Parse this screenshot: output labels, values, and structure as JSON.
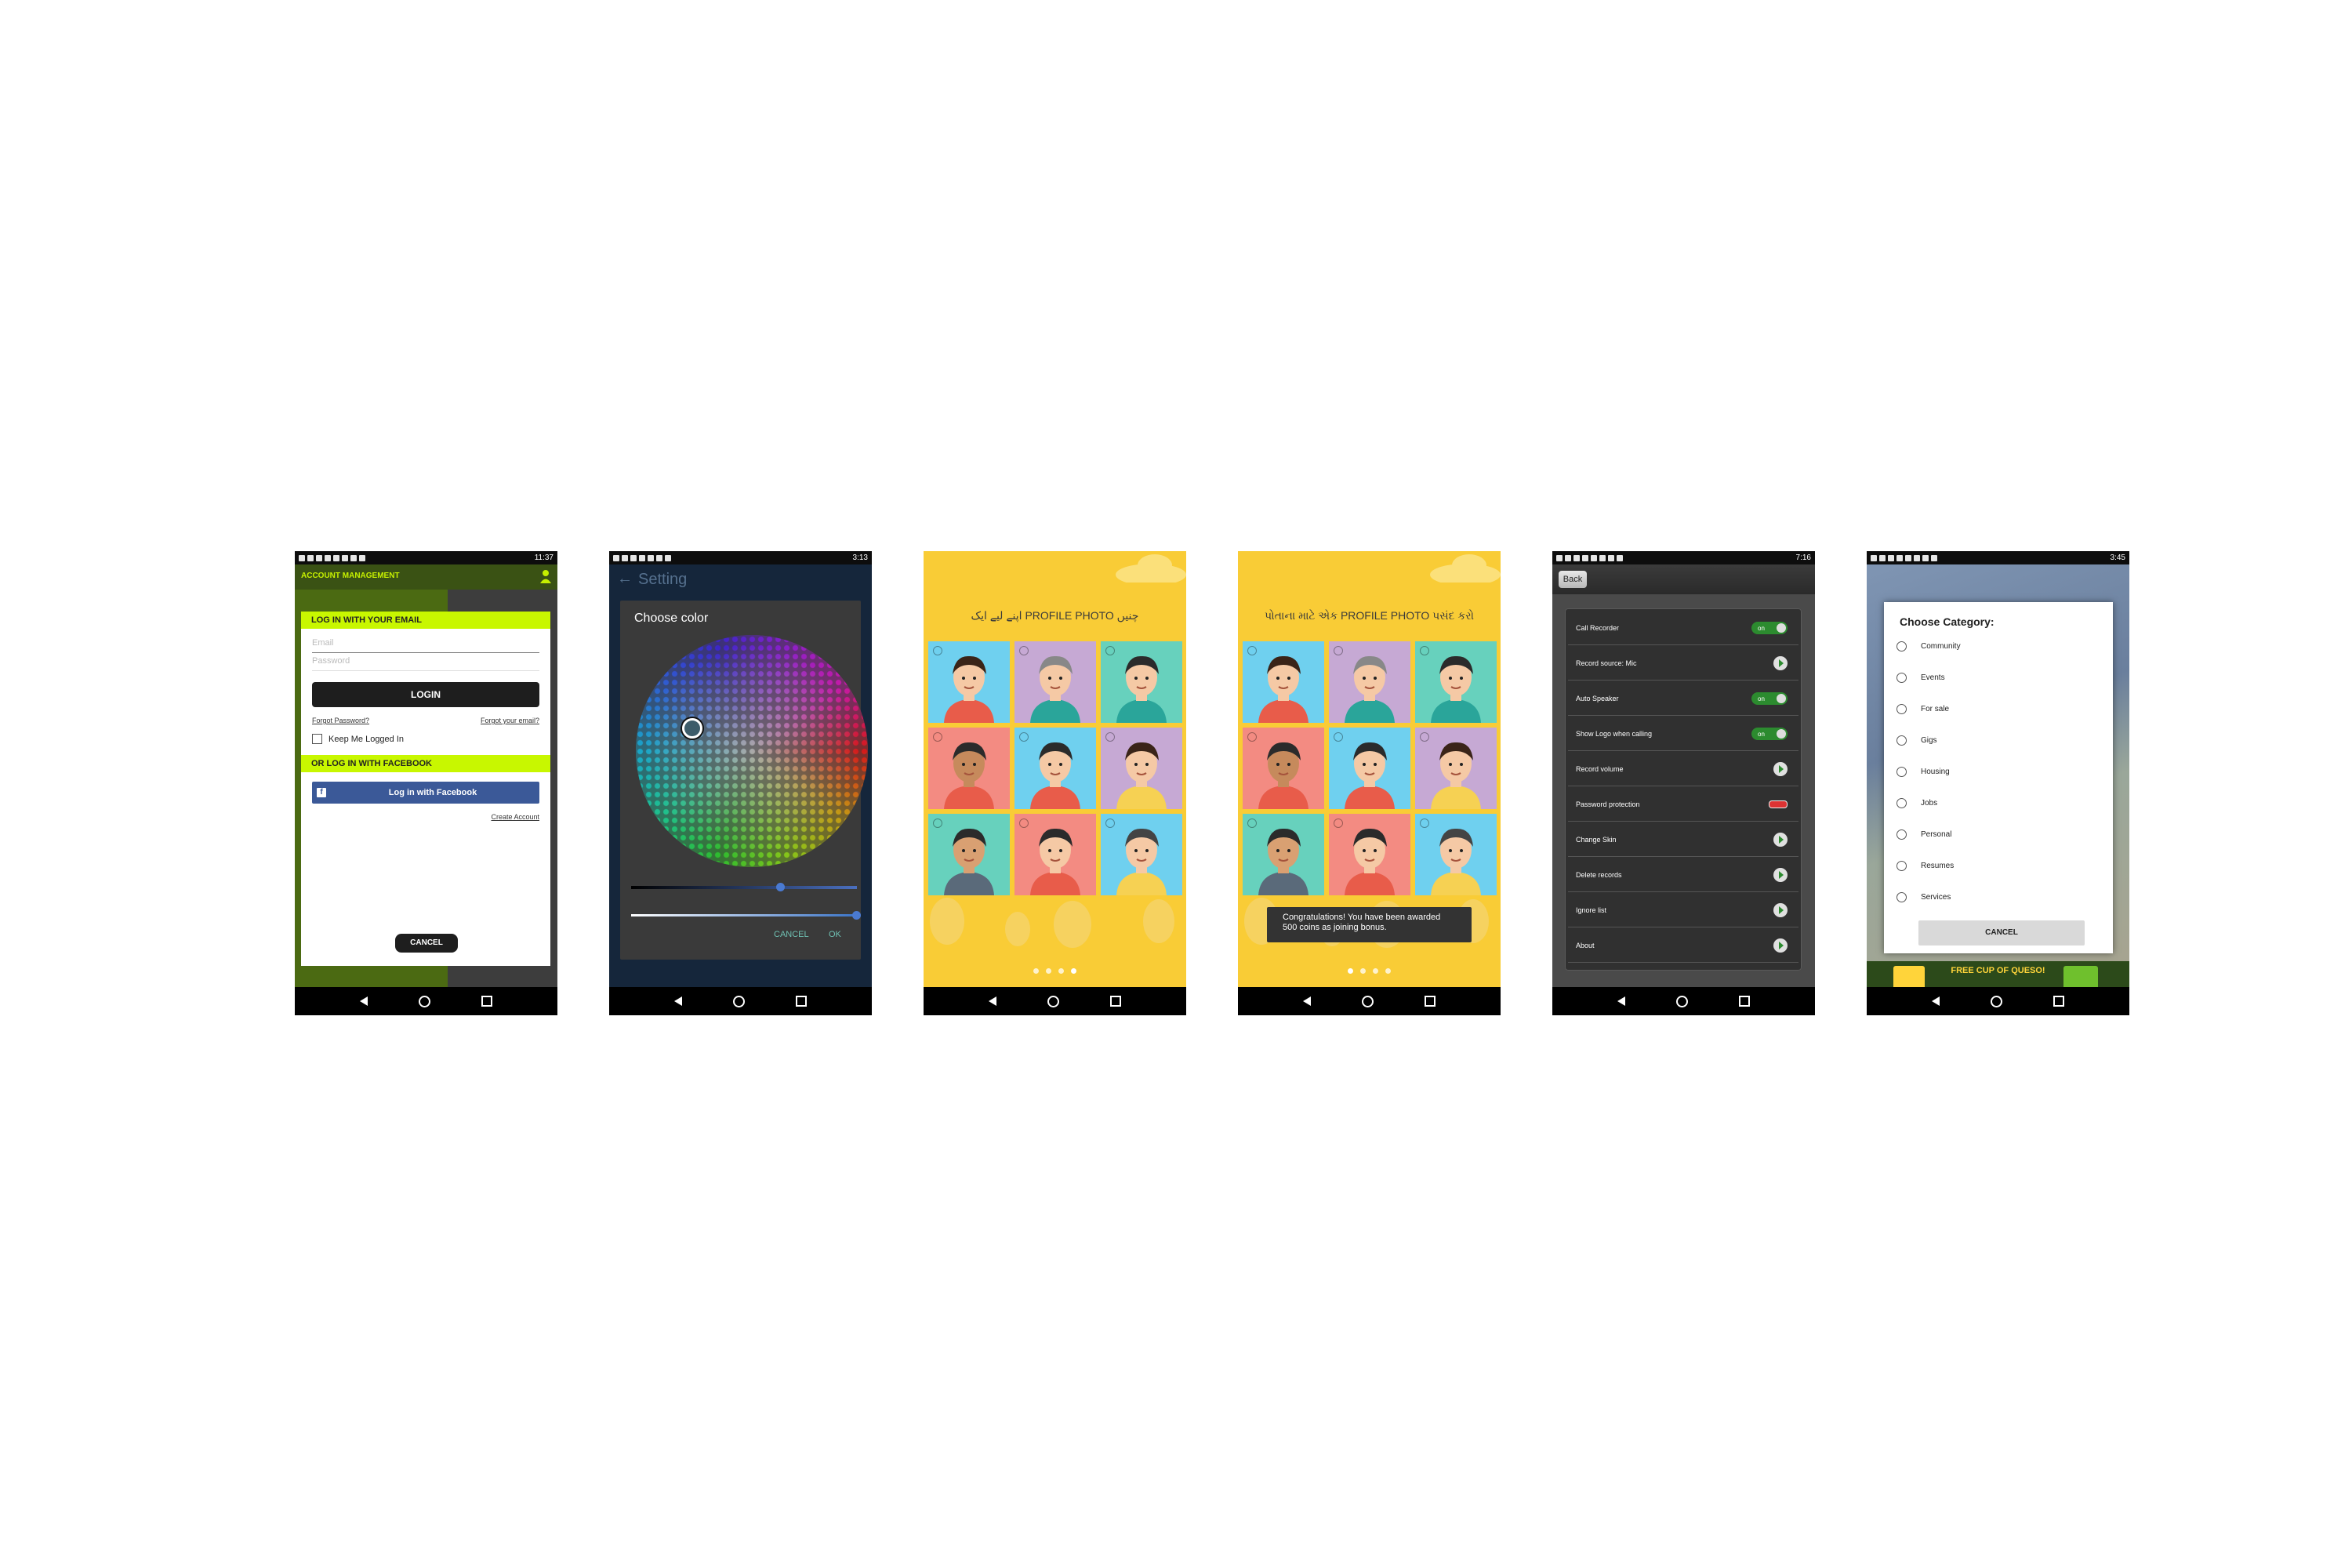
{
  "phones": [
    {
      "time": "11:37"
    },
    {
      "time": "3:13"
    },
    {
      "time": ""
    },
    {
      "time": ""
    },
    {
      "time": "7:16"
    },
    {
      "time": "3:45"
    }
  ],
  "login": {
    "app_title": "ACCOUNT MANAGEMENT",
    "email_header": "LOG IN WITH YOUR EMAIL",
    "email_placeholder": "Email",
    "password_placeholder": "Password",
    "login_button": "LOGIN",
    "forgot_password": "Forgot Password?",
    "forgot_email": "Forgot your email?",
    "keep_logged_in": "Keep Me Logged In",
    "facebook_header": "OR LOG IN WITH FACEBOOK",
    "facebook_button": "Log in with Facebook",
    "create_account": "Create Account",
    "cancel_button": "CANCEL"
  },
  "color_setting": {
    "title": "Setting",
    "dialog_title": "Choose color",
    "cancel_button": "CANCEL",
    "ok_button": "OK",
    "slider1_value": 0.66,
    "slider2_value": 1.0
  },
  "avatar_screens": [
    {
      "title": "اپنے لیے ایک PROFILE PHOTO چنیں",
      "active_page": 3
    },
    {
      "title": "પોતાના માટે એક PROFILE PHOTO પસંદ કરો",
      "active_page": 0,
      "toast": "Congratulations! You have been awarded 500 coins as joining bonus."
    }
  ],
  "recorder_settings": {
    "back_button": "Back",
    "rows": [
      {
        "label": "Call Recorder",
        "control": "toggle",
        "value": "on"
      },
      {
        "label": "Record source: Mic",
        "control": "arrow"
      },
      {
        "label": "Auto Speaker",
        "control": "toggle",
        "value": "on"
      },
      {
        "label": "Show Logo when calling",
        "control": "toggle",
        "value": "on"
      },
      {
        "label": "Record volume",
        "control": "arrow"
      },
      {
        "label": "Password protection",
        "control": "off"
      },
      {
        "label": "Change Skin",
        "control": "arrow"
      },
      {
        "label": "Delete records",
        "control": "arrow"
      },
      {
        "label": "Ignore list",
        "control": "arrow"
      },
      {
        "label": "About",
        "control": "arrow"
      }
    ]
  },
  "category": {
    "title": "Choose Category:",
    "options": [
      "Community",
      "Events",
      "For sale",
      "Gigs",
      "Housing",
      "Jobs",
      "Personal",
      "Resumes",
      "Services"
    ],
    "cancel_button": "CANCEL",
    "ad_text": "FREE CUP OF QUESO!"
  },
  "colors": {
    "accent_lime": "#c8f700",
    "facebook_blue": "#3b5998",
    "avatar_yellow": "#f9cc36",
    "toggle_green": "#2c8b2f"
  }
}
